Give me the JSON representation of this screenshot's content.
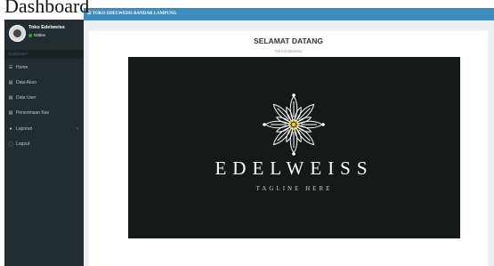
{
  "caption": "Dashboard",
  "header": {
    "title": "TOKO EDELWEISS BANDAR LAMPUNG",
    "menu_icon": "bars-icon"
  },
  "user": {
    "name": "Toko Edelweiss",
    "status": "Online"
  },
  "sidebar": {
    "section_label": "Dashboard",
    "items": [
      {
        "label": "Home",
        "icon": "home-icon"
      },
      {
        "label": "Data Akun",
        "icon": "table-icon"
      },
      {
        "label": "Data User",
        "icon": "table-icon"
      },
      {
        "label": "Penerimaan Kas",
        "icon": "table-icon"
      },
      {
        "label": "Laporan",
        "icon": "book-icon"
      },
      {
        "label": "Logout",
        "icon": "power-icon"
      }
    ]
  },
  "main": {
    "title": "SELAMAT DATANG",
    "subtitle": "Toko Edelweiss",
    "logo": {
      "brand": "EDELWEISS",
      "tagline": "TAGLINE HERE"
    }
  },
  "colors": {
    "sidebar": "#222d32",
    "header": "#3c8dbc",
    "content_bg": "#ecf0f5",
    "logo_bg": "#141a1a",
    "accent_gold": "#e8c33a"
  }
}
